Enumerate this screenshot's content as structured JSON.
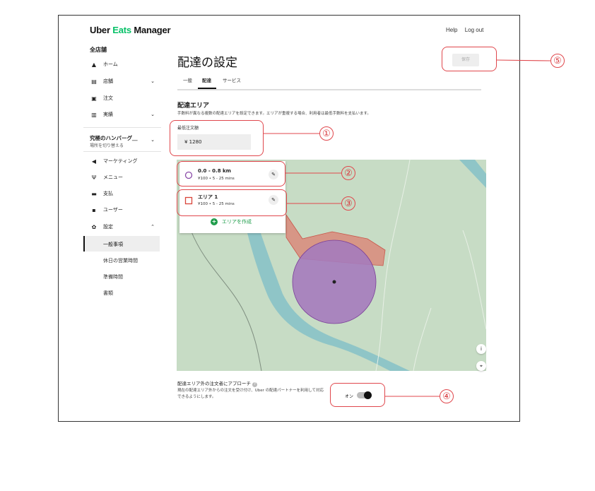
{
  "app": {
    "logo_prefix": "Uber ",
    "logo_eats": "Eats",
    "logo_suffix": " Manager",
    "help": "Help",
    "logout": "Log out"
  },
  "sidebar": {
    "all_stores": "全店舗",
    "items": [
      {
        "label": "ホーム",
        "icon": "home-icon",
        "glyph": "▲"
      },
      {
        "label": "店舗",
        "icon": "store-icon",
        "glyph": "▤"
      },
      {
        "label": "注文",
        "icon": "order-icon",
        "glyph": "▣"
      },
      {
        "label": "実績",
        "icon": "chart-icon",
        "glyph": "▥"
      }
    ],
    "store_name": "究極のハンバーグ＿",
    "store_switch": "場所を切り替える",
    "items2": [
      {
        "label": "マーケティング",
        "icon": "megaphone-icon",
        "glyph": "◀"
      },
      {
        "label": "メニュー",
        "icon": "cutlery-icon",
        "glyph": "Ψ"
      },
      {
        "label": "支払",
        "icon": "payment-icon",
        "glyph": "▬"
      },
      {
        "label": "ユーザー",
        "icon": "users-icon",
        "glyph": "▪"
      },
      {
        "label": "設定",
        "icon": "gear-icon",
        "glyph": "✿"
      }
    ],
    "settings_sub": [
      "一般事項",
      "休日の営業時間",
      "準備時間",
      "書類"
    ]
  },
  "page": {
    "title": "配達の設定",
    "save": "保存",
    "tabs": [
      "一般",
      "配達",
      "サービス"
    ],
    "section_title": "配達エリア",
    "section_desc": "手数料が異なる複数の配達エリアを設定できます。エリアが重複する場合、利用者は最低手数料を支払います。",
    "min_order_label": "最低注文額",
    "min_order_value": "¥  1280"
  },
  "zones": [
    {
      "title": "0.0 - 0.8 km",
      "sub": "¥100 • 5 - 25 mins",
      "shape": "circle",
      "color": "#8a4aa8"
    },
    {
      "title": "エリア 1",
      "sub": "¥100 • 5 - 25 mins",
      "shape": "square",
      "color": "#d9453a"
    }
  ],
  "add_area": "エリアを作成",
  "outside": {
    "title": "配達エリア外の注文者にアプローチ",
    "desc": "現在の配達エリア外からの注文を受け付け、Uber の配達パートナーを利用して対応できるようにします。",
    "toggle_label": "オン",
    "toggle_on": true
  },
  "callouts": [
    "①",
    "②",
    "③",
    "④",
    "⑤"
  ],
  "colors": {
    "accent": "#06c167",
    "callout": "#e0474c",
    "map_bg": "#c7dcc5",
    "river": "#8fc5c7",
    "zone_circle": "#a57bbd",
    "zone_poly": "#d9897a"
  }
}
